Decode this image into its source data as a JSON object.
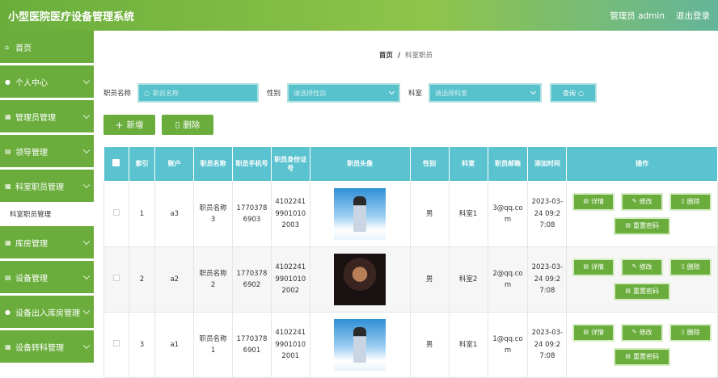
{
  "header": {
    "title": "小型医院医疗设备管理系统",
    "user": "管理员 admin",
    "logout": "退出登录"
  },
  "sidebar": {
    "items": [
      {
        "icon": "home-icon",
        "glyph": "⌂",
        "label": "首页",
        "chevron": false
      },
      {
        "icon": "user-icon",
        "glyph": "●",
        "label": "个人中心",
        "chevron": true
      },
      {
        "icon": "grid-icon",
        "glyph": "▦",
        "label": "管理员管理",
        "chevron": true
      },
      {
        "icon": "list-icon",
        "glyph": "▤",
        "label": "领导管理",
        "chevron": true
      },
      {
        "icon": "grid-icon",
        "glyph": "▦",
        "label": "科室职员管理",
        "chevron": true
      },
      {
        "icon": "grid-icon",
        "glyph": "▦",
        "label": "库房管理",
        "chevron": true
      },
      {
        "icon": "list-icon",
        "glyph": "▤",
        "label": "设备管理",
        "chevron": true
      },
      {
        "icon": "user-icon",
        "glyph": "●",
        "label": "设备出入库房管理",
        "chevron": true
      },
      {
        "icon": "grid-icon",
        "glyph": "▦",
        "label": "设备转科管理",
        "chevron": true
      }
    ],
    "sub_item": "科室职员管理"
  },
  "breadcrumb": {
    "home": "首页",
    "sep": "/",
    "current": "科室职员"
  },
  "search": {
    "name_label": "职员名称",
    "name_placeholder": "职员名称",
    "gender_label": "性别",
    "gender_placeholder": "请选择性别",
    "dept_label": "科室",
    "dept_placeholder": "请选择科室",
    "query": "查询"
  },
  "actions": {
    "add": "新增",
    "delete": "删除"
  },
  "table": {
    "headers": [
      "索引",
      "账户",
      "职员名称",
      "职员手机号",
      "职员身份证号",
      "职员头像",
      "性别",
      "科室",
      "职员邮箱",
      "添加时间",
      "操作"
    ],
    "rows": [
      {
        "index": "1",
        "account": "a3",
        "name": "职员名称3",
        "phone": "17703786903",
        "idcard": "410224199010102003",
        "avatar": "sky",
        "gender": "男",
        "dept": "科室1",
        "email": "3@qq.com",
        "time": "2023-03-24 09:27:08"
      },
      {
        "index": "2",
        "account": "a2",
        "name": "职员名称2",
        "phone": "17703786902",
        "idcard": "410224199010102002",
        "avatar": "dark",
        "gender": "男",
        "dept": "科室2",
        "email": "2@qq.com",
        "time": "2023-03-24 09:27:08"
      },
      {
        "index": "3",
        "account": "a1",
        "name": "职员名称1",
        "phone": "17703786901",
        "idcard": "410224199010102001",
        "avatar": "sky",
        "gender": "男",
        "dept": "科室1",
        "email": "1@qq.com",
        "time": "2023-03-24 09:27:08"
      }
    ],
    "ops": {
      "detail": "详情",
      "edit": "修改",
      "delete": "删除",
      "reset": "重置密码"
    }
  }
}
